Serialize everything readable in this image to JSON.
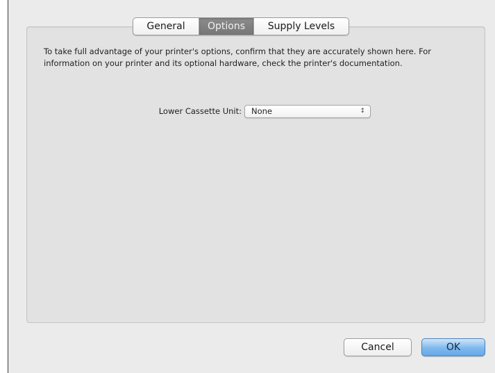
{
  "tabs": [
    {
      "label": "General",
      "selected": false
    },
    {
      "label": "Options",
      "selected": true
    },
    {
      "label": "Supply Levels",
      "selected": false
    }
  ],
  "options": {
    "description": "To take full advantage of your printer's options, confirm that they are accurately shown here. For information on your printer and its optional hardware, check the printer's documentation.",
    "lower_cassette_label": "Lower Cassette Unit:",
    "lower_cassette_value": "None"
  },
  "buttons": {
    "cancel_label": "Cancel",
    "ok_label": "OK"
  },
  "icons": {
    "popup_arrows": "up-down-chevron-icon"
  },
  "colors": {
    "selected_tab": "#808080",
    "default_button": "#7fb8ec"
  }
}
